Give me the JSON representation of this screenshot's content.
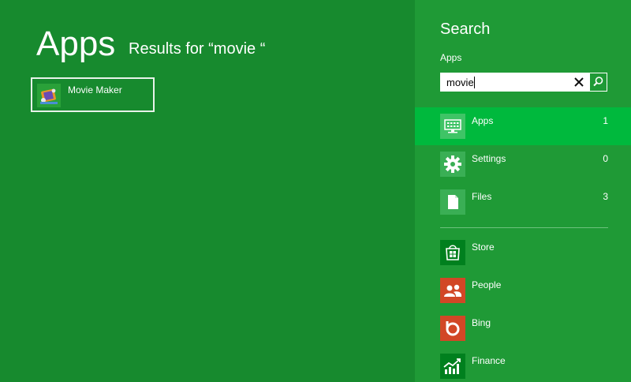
{
  "results": {
    "title": "Apps",
    "results_for": "Results for “movie “",
    "items": [
      {
        "label": "Movie Maker",
        "icon": "movie-maker-icon"
      }
    ]
  },
  "search": {
    "title": "Search",
    "scope": "Apps",
    "query": "movie"
  },
  "categories": [
    {
      "label": "Apps",
      "count": "1",
      "icon": "apps-icon",
      "selected": true
    },
    {
      "label": "Settings",
      "count": "0",
      "icon": "settings-icon",
      "selected": false
    },
    {
      "label": "Files",
      "count": "3",
      "icon": "files-icon",
      "selected": false
    }
  ],
  "apps": [
    {
      "label": "Store",
      "icon": "store-icon",
      "color": "#00801e"
    },
    {
      "label": "People",
      "icon": "people-icon",
      "color": "#d24726"
    },
    {
      "label": "Bing",
      "icon": "bing-icon",
      "color": "#d24726"
    },
    {
      "label": "Finance",
      "icon": "finance-icon",
      "color": "#00801e"
    }
  ],
  "colors": {
    "background": "#178a2e",
    "pane": "#1f9a36",
    "selected": "#00b93d"
  }
}
